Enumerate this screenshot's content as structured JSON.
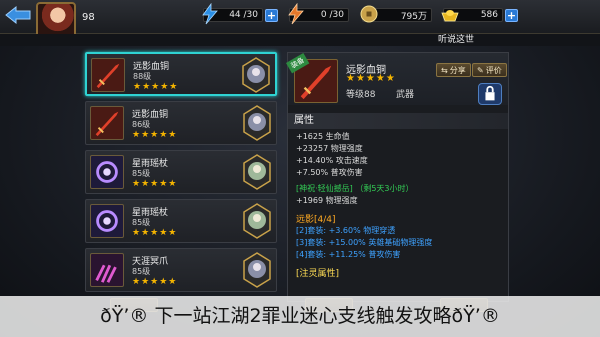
{
  "topbar": {
    "level": "98",
    "stamina": "44 /30",
    "energy": "0 /30",
    "coins": "795万",
    "gold": "586",
    "banner": "听说这世"
  },
  "list": {
    "items": [
      {
        "name": "远影血铜",
        "level": "88级",
        "stars": "★★★★★",
        "selected": true
      },
      {
        "name": "远影血铜",
        "level": "86级",
        "stars": "★★★★★",
        "selected": false
      },
      {
        "name": "星雨瑶杖",
        "level": "85级",
        "stars": "★★★★★",
        "selected": false
      },
      {
        "name": "星雨瑶杖",
        "level": "85级",
        "stars": "★★★★★",
        "selected": false
      },
      {
        "name": "天涯冥爪",
        "level": "85级",
        "stars": "★★★★★",
        "selected": false
      }
    ]
  },
  "detail": {
    "tag": "装备",
    "name": "远影血铜",
    "stars": "★★★★★",
    "level": "等级88",
    "type": "武器",
    "share": "分享",
    "review": "评价",
    "attr_title": "属性",
    "stats": [
      "+1625 生命值",
      "+23257 物理强度",
      "+14.40% 攻击速度",
      "+7.50% 普攻伤害"
    ],
    "blessing": "[神祝·轻仙撼岳] （剩5天3小时）",
    "blessing_stat": "+1969 物理强度",
    "set_title": "远影[4/4]",
    "set_lines": [
      "[2]套装: +3.60% 物理穿透",
      "[3]套装: +15.00% 英雄基础物理强度",
      "[4]套装: +11.25% 普攻伤害"
    ],
    "spirit_title": "[注灵属性]"
  },
  "caption": "ðŸ’® 下一站江湖2罪业迷心支线触发攻略ðŸ’®",
  "colors": {
    "accent": "#2fd3d3",
    "star": "#f4b400",
    "green": "#33cc55",
    "blue": "#3ea2ff"
  }
}
